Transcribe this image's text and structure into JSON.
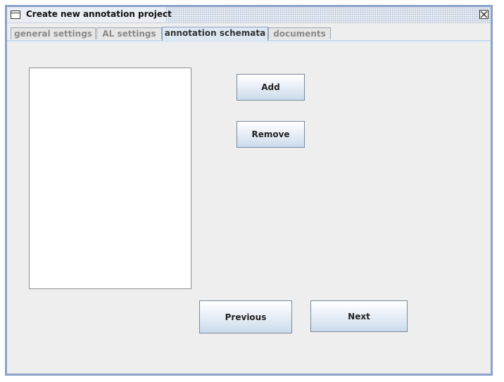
{
  "window": {
    "title": "Create new annotation project"
  },
  "tabs": [
    {
      "label": "general settings",
      "active": false
    },
    {
      "label": "AL settings",
      "active": false
    },
    {
      "label": "annotation schemata",
      "active": true
    },
    {
      "label": "documents",
      "active": false
    }
  ],
  "schemata": {
    "list_items": [],
    "add_label": "Add",
    "remove_label": "Remove"
  },
  "navigation": {
    "previous_label": "Previous",
    "next_label": "Next"
  },
  "icons": {
    "window": "window-icon",
    "close": "close-icon"
  },
  "colors": {
    "window_border": "#8ca2c8",
    "active_tab": "#dde8f3",
    "panel_background": "#eeeeee"
  }
}
